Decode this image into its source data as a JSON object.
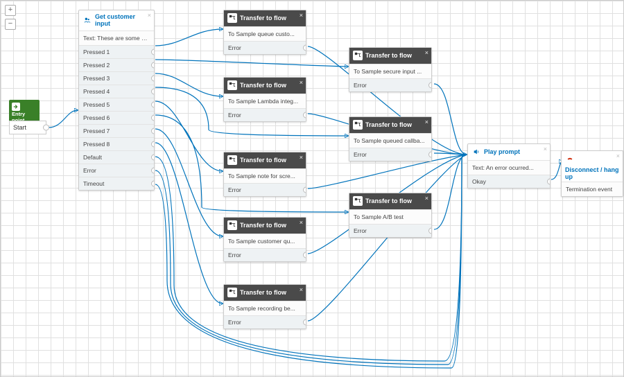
{
  "zoom": {
    "plus": "+",
    "minus": "−"
  },
  "entry": {
    "label": "Entry point",
    "start": "Start"
  },
  "gci": {
    "title": "Get customer input",
    "text": "Text: These are some ex...",
    "ports": [
      "Pressed 1",
      "Pressed 2",
      "Pressed 3",
      "Pressed 4",
      "Pressed 5",
      "Pressed 6",
      "Pressed 7",
      "Pressed 8",
      "Default",
      "Error",
      "Timeout"
    ]
  },
  "transfer_label": "Transfer to flow",
  "error_label": "Error",
  "tf": [
    "To Sample queue custo...",
    "To Sample Lambda integ...",
    "To Sample note for scre...",
    "To Sample customer qu...",
    "To Sample recording be...",
    "To Sample secure input ...",
    "To Sample queued callba...",
    "To Sample A/B test"
  ],
  "prompt": {
    "title": "Play prompt",
    "text": "Text: An error ocurred...",
    "okay": "Okay"
  },
  "disc": {
    "title": "Disconnect / hang up",
    "sub": "Termination event"
  }
}
